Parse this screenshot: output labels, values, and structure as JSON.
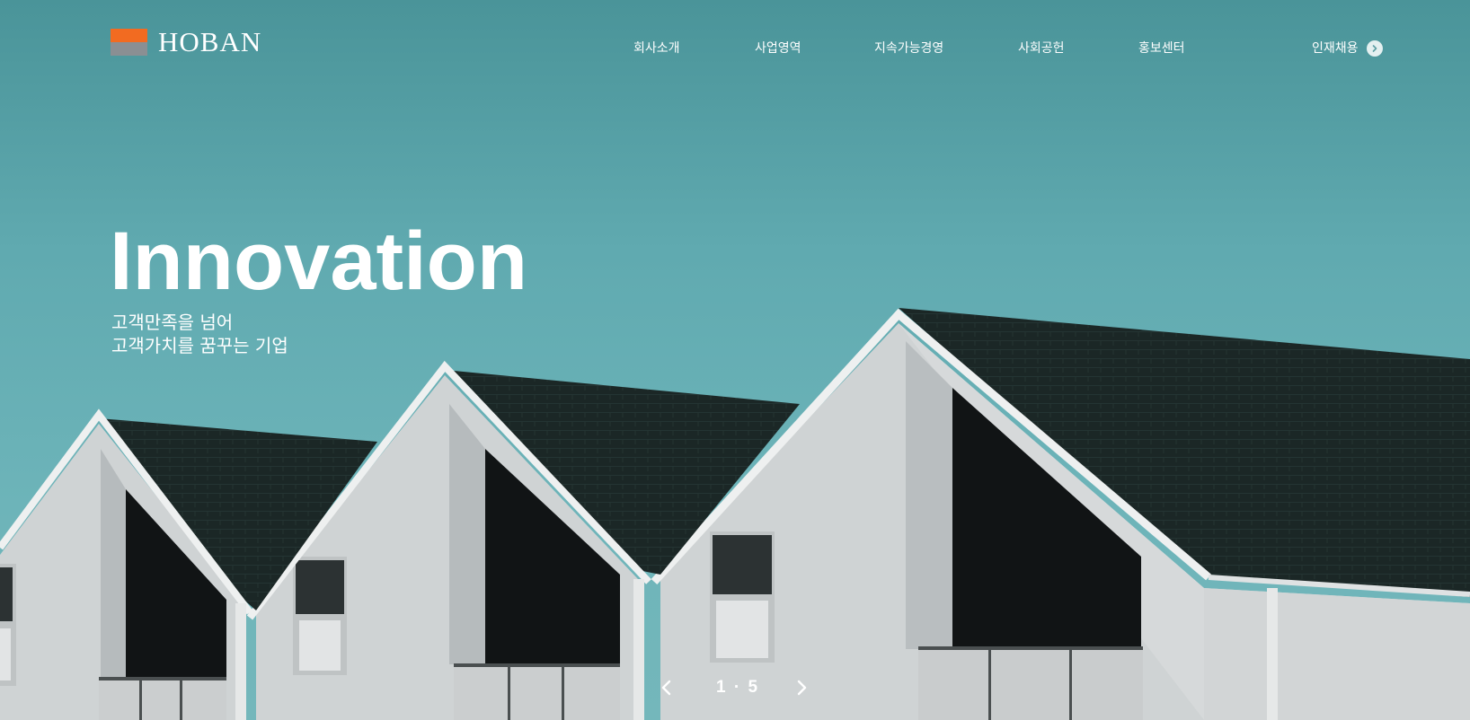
{
  "brand": {
    "name": "HOBAN",
    "colors": {
      "orange": "#f26b21",
      "gray": "#8a8f93"
    }
  },
  "nav": {
    "items": [
      {
        "label": "회사소개"
      },
      {
        "label": "사업영역"
      },
      {
        "label": "지속가능경영"
      },
      {
        "label": "사회공헌"
      },
      {
        "label": "홍보센터"
      }
    ],
    "recruit": {
      "label": "인재채용",
      "icon": "chevron-right-circle-icon"
    }
  },
  "hero": {
    "headline": "Innovation",
    "subline_1": "고객만족을 넘어",
    "subline_2": "고객가치를 꿈꾸는 기업"
  },
  "slider": {
    "current": "1",
    "separator": "·",
    "total": "5",
    "prev_icon": "chevron-left-icon",
    "next_icon": "chevron-right-icon"
  }
}
